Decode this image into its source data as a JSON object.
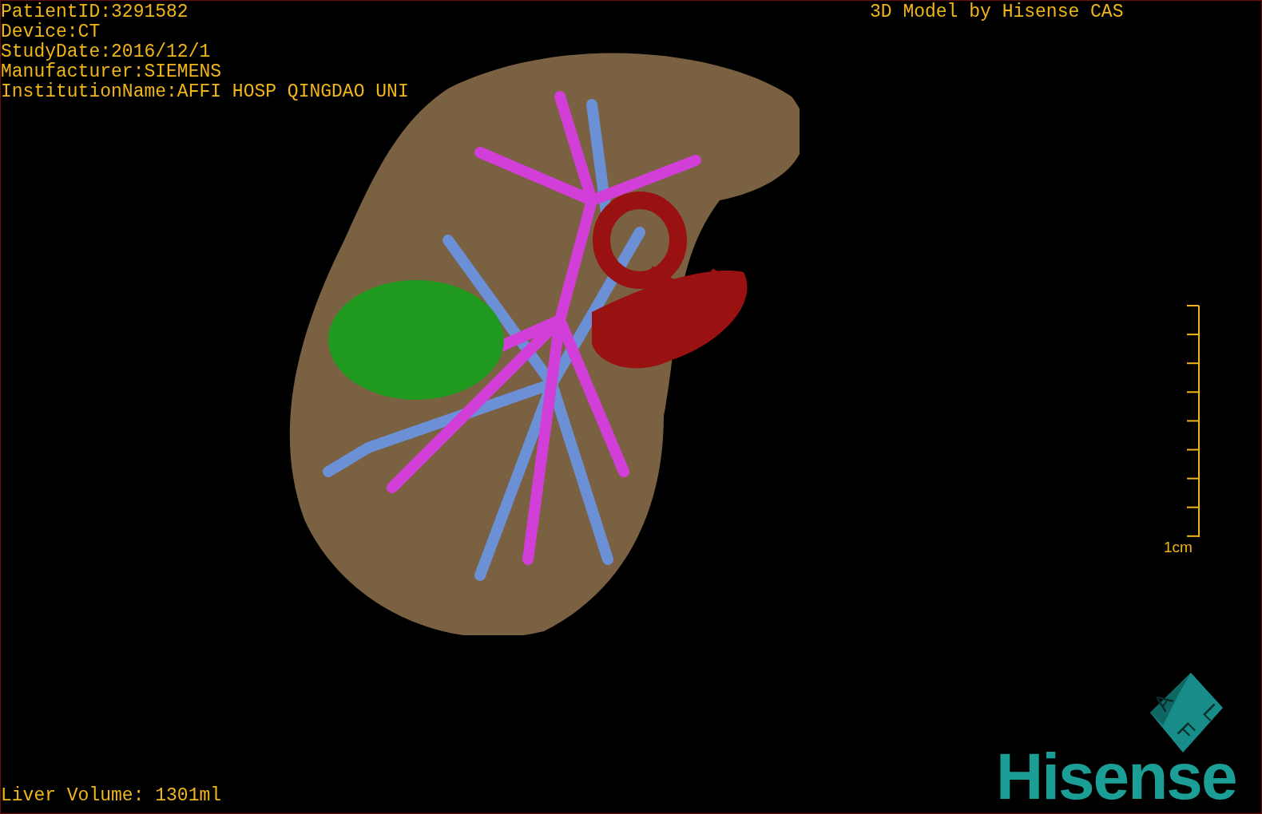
{
  "patient_info": [
    "PatientID:3291582",
    "Device:CT",
    "StudyDate:2016/12/1",
    "Manufacturer:SIEMENS",
    "InstitutionName:AFFI HOSP QINGDAO UNI"
  ],
  "header": "3D Model by Hisense CAS",
  "scale_bar": {
    "label": "1cm"
  },
  "orientation_cube": {
    "labels": [
      "A",
      "F",
      "L"
    ]
  },
  "logo": "Hisense",
  "footer": "Liver Volume: 1301ml"
}
